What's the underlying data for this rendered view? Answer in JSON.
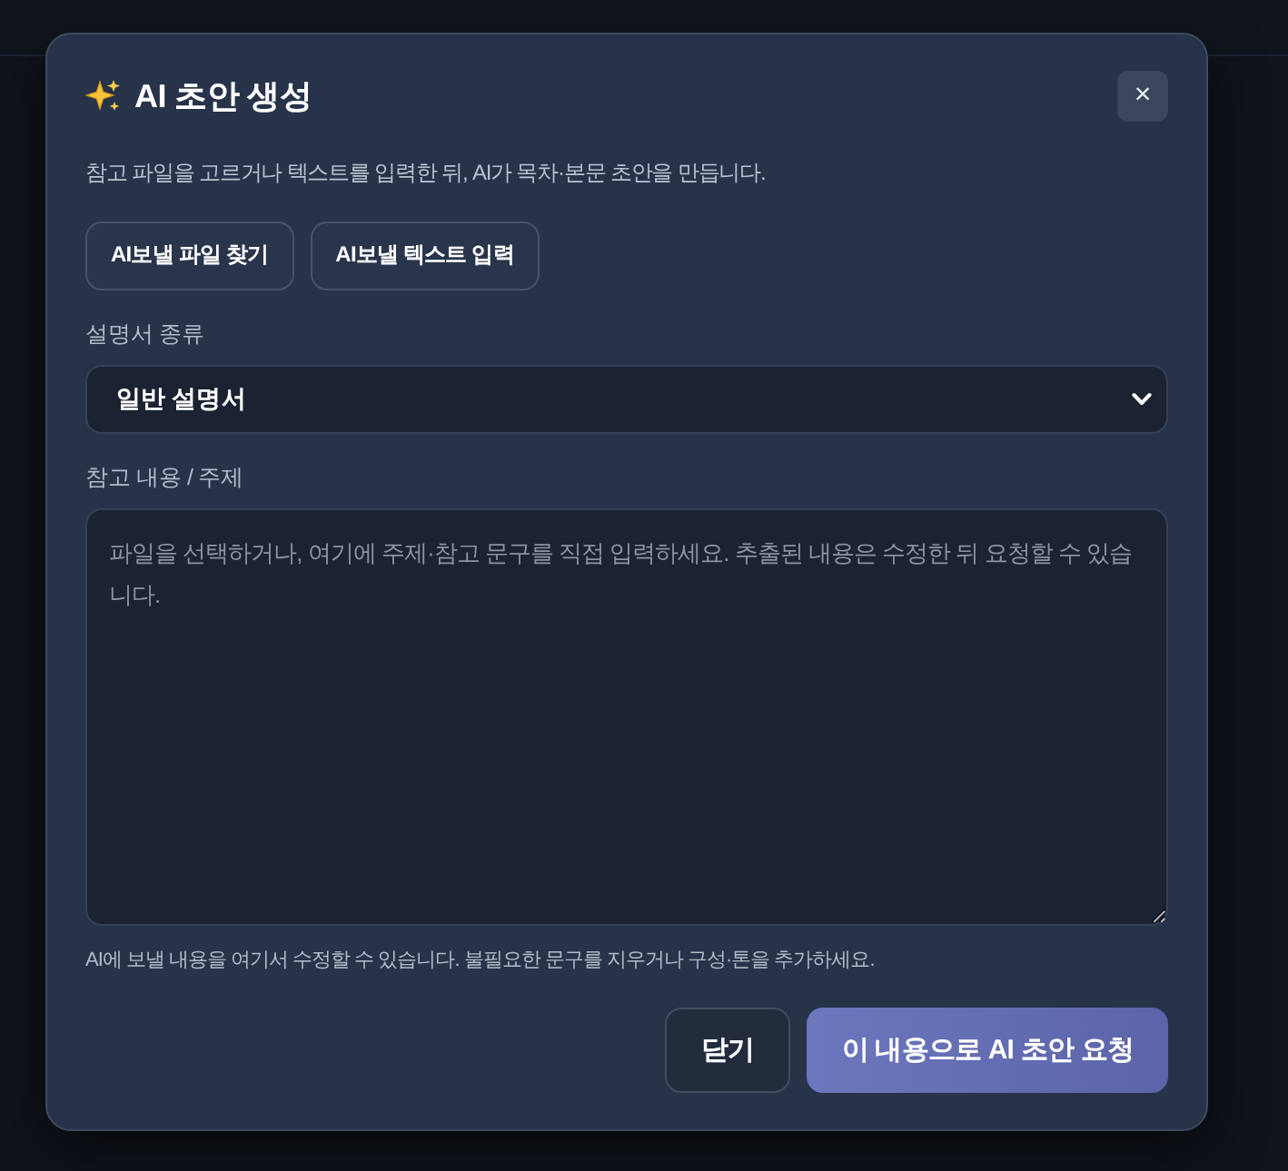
{
  "dialog": {
    "title": "AI 초안 생성",
    "close_button": "×",
    "description": "참고 파일을 고르거나 텍스트를 입력한 뒤, AI가 목차·본문 초안을 만듭니다.",
    "source_buttons": [
      "AI보낼 파일 찾기",
      "AI보낼 텍스트 입력"
    ],
    "document_type": {
      "label": "설명서 종류",
      "value": "일반 설명서"
    },
    "reference": {
      "label": "참고 내용 / 주제",
      "placeholder": "파일을 선택하거나, 여기에 주제·참고 문구를 직접 입력하세요. 추출된 내용은 수정한 뒤 요청할 수 있습니다."
    },
    "hint": "AI에 보낼 내용을 여기서 수정할 수 있습니다. 불필요한 문구를 지우거나 구성·톤을 추가하세요.",
    "actions": [
      {
        "label": "닫기",
        "kind": "secondary"
      },
      {
        "label": "이 내용으로 AI 초안 요청",
        "kind": "primary"
      }
    ]
  }
}
